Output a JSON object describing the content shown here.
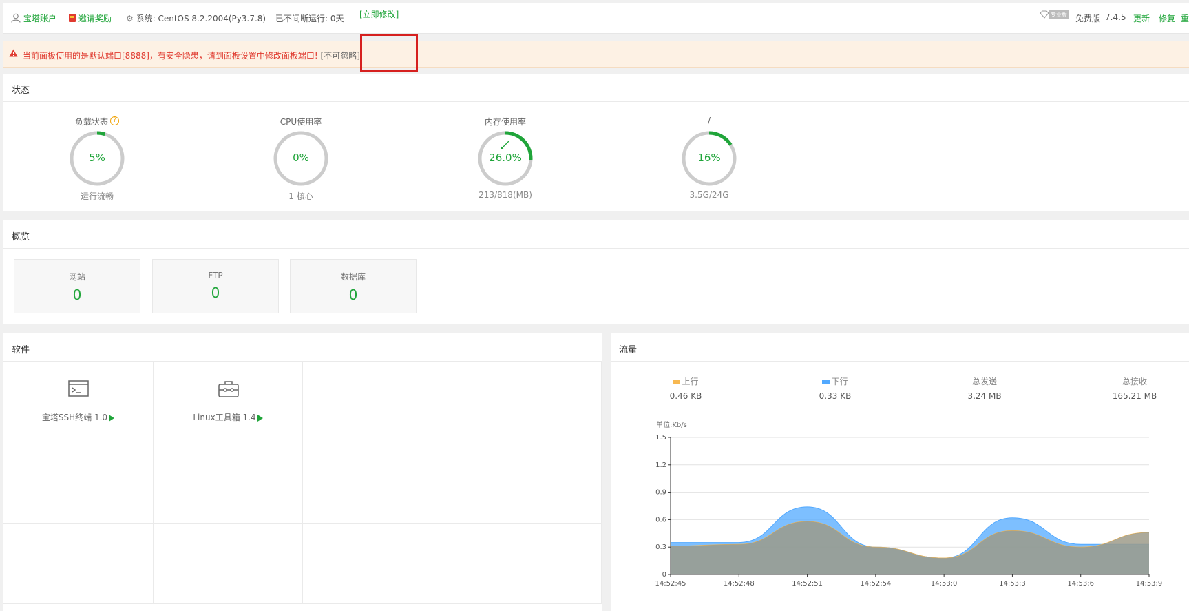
{
  "topbar": {
    "account": "宝塔账户",
    "invite": "邀请奖励",
    "system_label": "系统:",
    "system_value": "CentOS 8.2.2004(Py3.7.8)",
    "uptime": "已不间断运行: 0天",
    "pro_badge": "专业版",
    "edition": "免费版",
    "version": "7.4.5",
    "update": "更新",
    "repair": "修复",
    "restart": "重启"
  },
  "warning": {
    "text": "当前面板使用的是默认端口[8888]，有安全隐患，请到面板设置中修改面板端口!",
    "ignore": "[不可忽略]",
    "link": "[立即修改]"
  },
  "status": {
    "title": "状态",
    "gauges": [
      {
        "label": "负载状态",
        "value": "5%",
        "sub": "运行流畅",
        "fraction": 0.05
      },
      {
        "label": "CPU使用率",
        "value": "0%",
        "sub": "1 核心",
        "fraction": 0.0
      },
      {
        "label": "内存使用率",
        "value": "26.0%",
        "sub": "213/818(MB)",
        "fraction": 0.26
      },
      {
        "label": "/",
        "value": "16%",
        "sub": "3.5G/24G",
        "fraction": 0.16
      }
    ]
  },
  "overview": {
    "title": "概览",
    "items": [
      {
        "label": "网站",
        "value": "0"
      },
      {
        "label": "FTP",
        "value": "0"
      },
      {
        "label": "数据库",
        "value": "0"
      }
    ]
  },
  "software": {
    "title": "软件",
    "items": [
      {
        "name": "宝塔SSH终端 1.0",
        "icon": "terminal-icon"
      },
      {
        "name": "Linux工具箱 1.4",
        "icon": "toolbox-icon"
      }
    ]
  },
  "traffic": {
    "title": "流量",
    "stats": [
      {
        "label": "上行",
        "value": "0.46 KB",
        "color": "#f7b851"
      },
      {
        "label": "下行",
        "value": "0.33 KB",
        "color": "#52a9ff"
      },
      {
        "label": "总发送",
        "value": "3.24 MB"
      },
      {
        "label": "总接收",
        "value": "165.21 MB"
      }
    ],
    "unit": "单位:Kb/s"
  },
  "chart_data": {
    "type": "area",
    "x": [
      "14:52:45",
      "14:52:48",
      "14:52:51",
      "14:52:54",
      "14:53:0",
      "14:53:3",
      "14:53:6",
      "14:53:9"
    ],
    "ylim": [
      0,
      1.5
    ],
    "yticks": [
      "0",
      "0.3",
      "0.6",
      "0.9",
      "1.2",
      "1.5"
    ],
    "ylabel": "单位:Kb/s",
    "grid": true,
    "series": [
      {
        "name": "上行",
        "color": "#f7b851",
        "values": [
          0.31,
          0.33,
          0.58,
          0.3,
          0.18,
          0.48,
          0.3,
          0.46
        ]
      },
      {
        "name": "下行",
        "color": "#52a9ff",
        "values": [
          0.35,
          0.35,
          0.74,
          0.3,
          0.18,
          0.62,
          0.33,
          0.33
        ]
      }
    ]
  }
}
